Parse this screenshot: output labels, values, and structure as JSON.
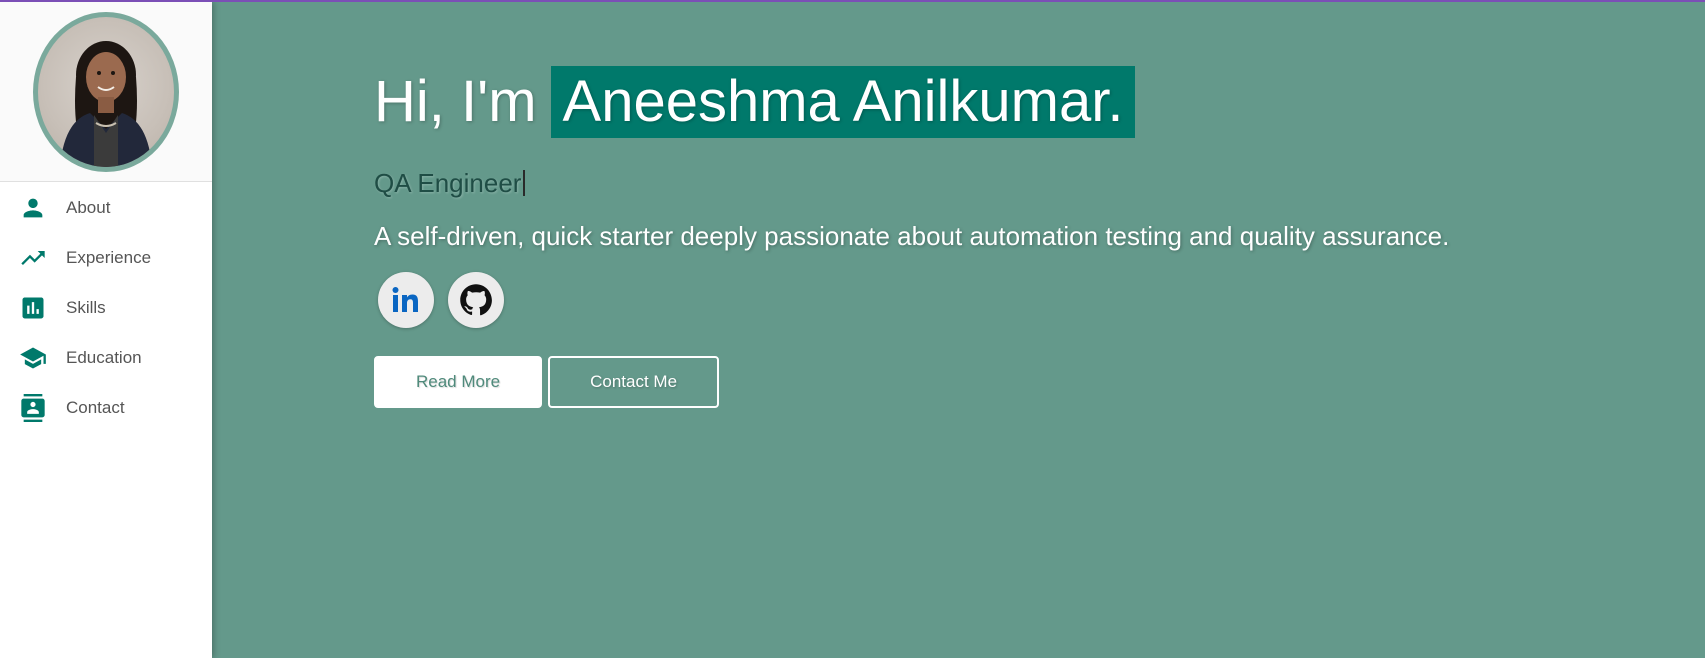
{
  "colors": {
    "sidebar_bg": "#ffffff",
    "main_bg": "#64998b",
    "accent": "#00796b",
    "top_border": "#7b4fb6"
  },
  "sidebar": {
    "items": [
      {
        "label": "About",
        "icon": "person-icon"
      },
      {
        "label": "Experience",
        "icon": "trending-up-icon"
      },
      {
        "label": "Skills",
        "icon": "bar-chart-icon"
      },
      {
        "label": "Education",
        "icon": "graduation-cap-icon"
      },
      {
        "label": "Contact",
        "icon": "contact-card-icon"
      }
    ]
  },
  "hero": {
    "greeting": "Hi, I'm",
    "name": "Aneeshma Anilkumar.",
    "role": "QA Engineer",
    "description": "A self-driven, quick starter deeply passionate about automation testing and quality assurance."
  },
  "socials": [
    {
      "icon": "linkedin-icon",
      "label": "in"
    },
    {
      "icon": "github-icon"
    }
  ],
  "buttons": {
    "read_more": "Read More",
    "contact_me": "Contact Me"
  }
}
